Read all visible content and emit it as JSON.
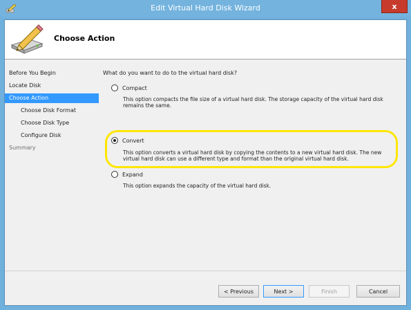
{
  "window": {
    "title": "Edit Virtual Hard Disk Wizard",
    "close_label": "x"
  },
  "header": {
    "title": "Choose Action"
  },
  "nav": {
    "items": [
      {
        "label": "Before You Begin"
      },
      {
        "label": "Locate Disk"
      },
      {
        "label": "Choose Action"
      },
      {
        "label": "Choose Disk Format"
      },
      {
        "label": "Choose Disk Type"
      },
      {
        "label": "Configure Disk"
      },
      {
        "label": "Summary"
      }
    ],
    "selected": "Choose Action"
  },
  "content": {
    "question": "What do you want to do to the virtual hard disk?",
    "options": [
      {
        "label": "Compact",
        "description": "This option compacts the file size of a virtual hard disk. The storage capacity of the virtual hard disk remains the same.",
        "checked": false
      },
      {
        "label": "Convert",
        "description": "This option converts a virtual hard disk by copying the contents to a new virtual hard disk. The new virtual hard disk can use a different type and format than the original virtual hard disk.",
        "checked": true
      },
      {
        "label": "Expand",
        "description": "This option expands the capacity of the virtual hard disk.",
        "checked": false
      }
    ],
    "highlight_color": "#ffe600"
  },
  "buttons": {
    "previous": "< Previous",
    "next": "Next >",
    "finish": "Finish",
    "cancel": "Cancel"
  },
  "colors": {
    "titlebar": "#74b3de",
    "close": "#c63b2c",
    "selection": "#3399ff"
  },
  "icons": {
    "title": "wizard-pencil-icon",
    "header": "disk-pencil-icon"
  }
}
